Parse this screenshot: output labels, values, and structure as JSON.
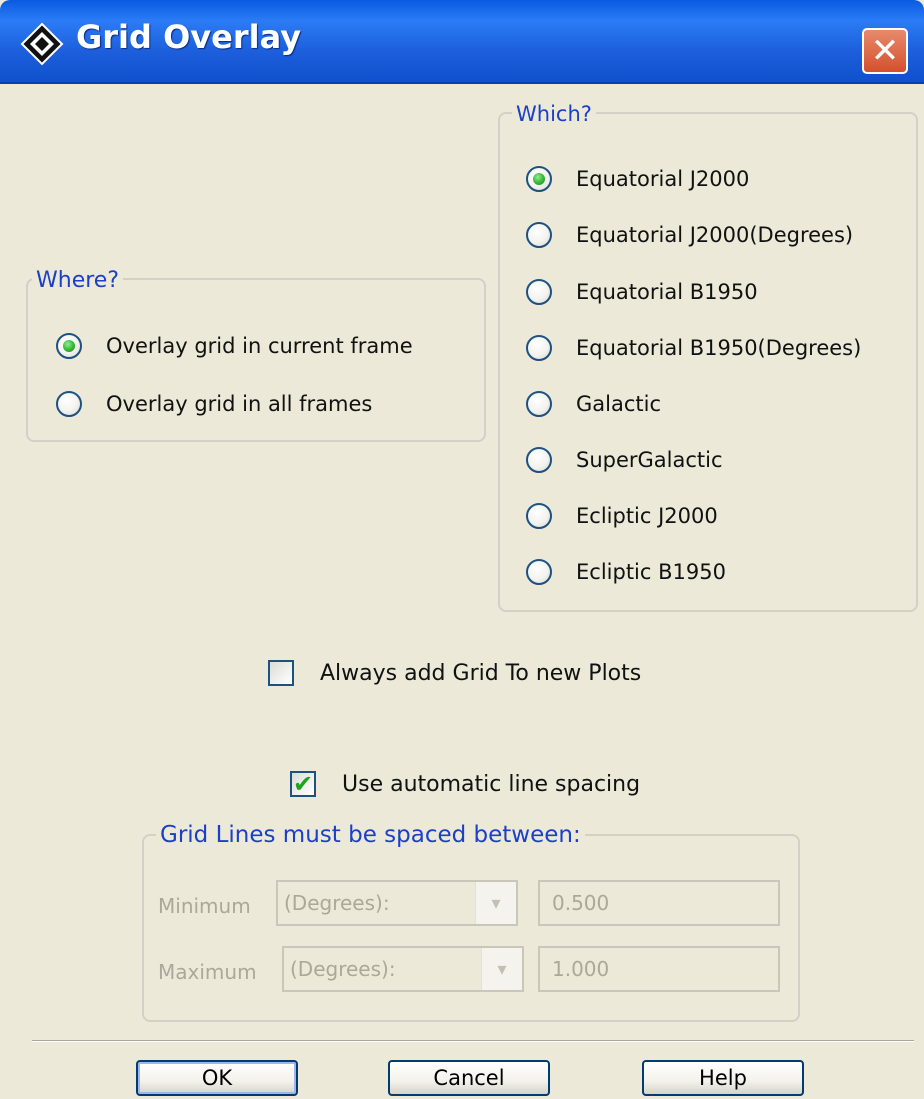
{
  "window": {
    "title": "Grid Overlay",
    "close_glyph": "✕",
    "app_icon": "diamond-icon"
  },
  "where": {
    "legend": "Where?",
    "options": [
      {
        "label": "Overlay grid in current frame",
        "selected": true
      },
      {
        "label": "Overlay grid in all frames",
        "selected": false
      }
    ]
  },
  "which": {
    "legend": "Which?",
    "options": [
      {
        "label": "Equatorial J2000",
        "selected": true
      },
      {
        "label": "Equatorial J2000(Degrees)",
        "selected": false
      },
      {
        "label": "Equatorial B1950",
        "selected": false
      },
      {
        "label": "Equatorial B1950(Degrees)",
        "selected": false
      },
      {
        "label": "Galactic",
        "selected": false
      },
      {
        "label": "SuperGalactic",
        "selected": false
      },
      {
        "label": "Ecliptic J2000",
        "selected": false
      },
      {
        "label": "Ecliptic B1950",
        "selected": false
      }
    ]
  },
  "always_add": {
    "label": "Always add Grid To new Plots",
    "checked": false
  },
  "auto_spacing": {
    "label": "Use automatic line spacing",
    "checked": true,
    "check_glyph": "✔"
  },
  "spacing": {
    "legend": "Grid Lines must be spaced between:",
    "minimum": {
      "label": "Minimum",
      "unit": "(Degrees):",
      "value": "0.500"
    },
    "maximum": {
      "label": "Maximum",
      "unit": "(Degrees):",
      "value": "1.000"
    },
    "arrow_glyph": "▾"
  },
  "buttons": {
    "ok": "OK",
    "cancel": "Cancel",
    "help": "Help"
  },
  "colors": {
    "title_bar": "#2b7cf5",
    "legend_text": "#1a3fc8",
    "selected_dot": "#34b434",
    "background": "#ece9d8"
  }
}
